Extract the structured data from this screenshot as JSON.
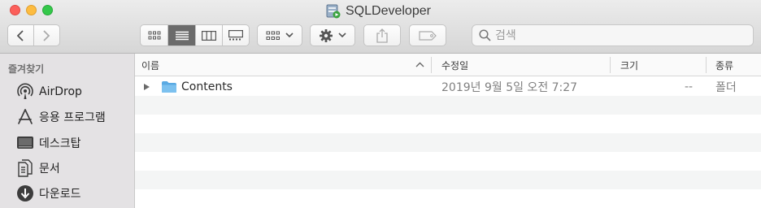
{
  "window": {
    "title": "SQLDeveloper"
  },
  "toolbar": {
    "back_icon": "chevron-left-icon",
    "forward_icon": "chevron-right-icon",
    "view_modes": [
      "icon-view-icon",
      "list-view-icon",
      "column-view-icon",
      "gallery-view-icon"
    ],
    "active_view": "list-view-icon"
  },
  "search": {
    "placeholder": "검색"
  },
  "sidebar": {
    "section": "즐겨찾기",
    "items": [
      {
        "label": "AirDrop",
        "icon": "airdrop-icon"
      },
      {
        "label": "응용 프로그램",
        "icon": "applications-icon"
      },
      {
        "label": "데스크탑",
        "icon": "desktop-icon"
      },
      {
        "label": "문서",
        "icon": "documents-icon"
      },
      {
        "label": "다운로드",
        "icon": "downloads-icon"
      }
    ]
  },
  "columns": {
    "name": "이름",
    "modified": "수정일",
    "size": "크기",
    "kind": "종류"
  },
  "files": [
    {
      "name": "Contents",
      "modified": "2019년 9월 5일 오전 7:27",
      "size": "--",
      "kind": "폴더"
    }
  ],
  "colors": {
    "folder": "#6cb4e6",
    "active_segment": "#6b6b6b"
  }
}
